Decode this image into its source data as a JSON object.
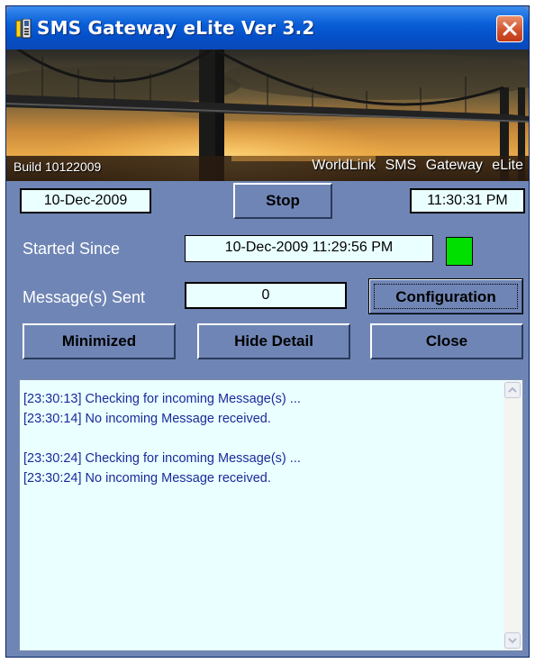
{
  "window": {
    "title": "SMS Gateway eLite Ver 3.2"
  },
  "banner": {
    "build": "Build 10122009",
    "brand": "WorldLink SMS Gateway eLite"
  },
  "status": {
    "date": "10-Dec-2009",
    "time": "11:30:31 PM",
    "started_since_label": "Started Since",
    "started_since_value": "10-Dec-2009 11:29:56 PM",
    "messages_sent_label": "Message(s) Sent",
    "messages_sent_value": "0",
    "indicator_color": "#00e000"
  },
  "buttons": {
    "stop": "Stop",
    "configuration": "Configuration",
    "minimized": "Minimized",
    "hide_detail": "Hide Detail",
    "close": "Close"
  },
  "log": [
    "[23:30:13] Checking for incoming Message(s) ...",
    "[23:30:14] No incoming Message received.",
    "",
    "[23:30:24] Checking for incoming Message(s) ...",
    "[23:30:24] No incoming Message received."
  ],
  "colors": {
    "window_bg": "#6f85b5",
    "field_bg": "#eaffff",
    "log_text": "#1a2a9c"
  }
}
